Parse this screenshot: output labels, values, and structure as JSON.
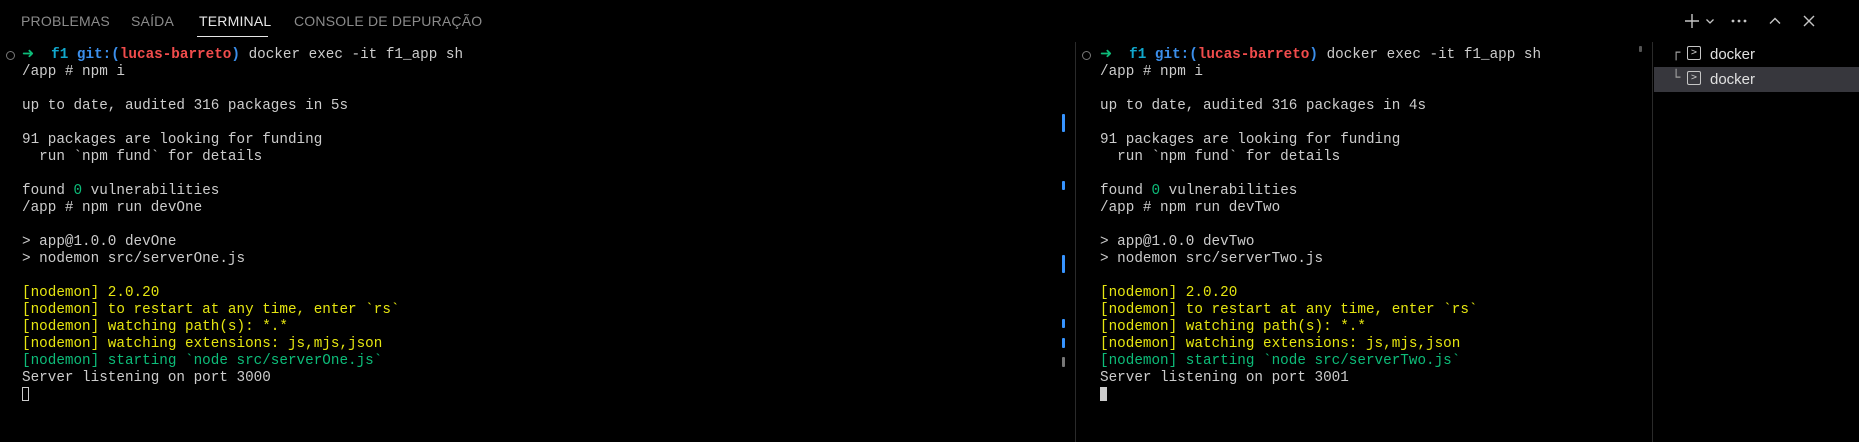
{
  "tabs": [
    {
      "label": "PROBLEMAS",
      "active": false
    },
    {
      "label": "SAÍDA",
      "active": false
    },
    {
      "label": "TERMINAL",
      "active": true
    },
    {
      "label": "CONSOLE DE DEPURAÇÃO",
      "active": false
    }
  ],
  "toolbar": {
    "new_terminal_icon": "plus-icon",
    "dropdown_icon": "chevron-down-icon",
    "more_icon": "ellipsis-icon",
    "maximize_icon": "chevron-up-icon",
    "close_icon": "close-icon"
  },
  "terminals": [
    {
      "prompt_arrow": "➜",
      "folder": "f1",
      "git_prefix": "git:(",
      "branch": "lucas-barreto",
      "git_suffix": ")",
      "command": "docker exec -it f1_app sh",
      "npm_i": "/app # npm i",
      "audited": "up to date, audited 316 packages in 5s",
      "funding1": "91 packages are looking for funding",
      "funding2": "  run `npm fund` for details",
      "found_pre": "found ",
      "vuln_count": "0",
      "found_post": " vulnerabilities",
      "run_cmd": "/app # npm run devOne",
      "app_line": "> app@1.0.0 devOne",
      "nodemon_line": "> nodemon src/serverOne.js",
      "nm1": "[nodemon] 2.0.20",
      "nm2": "[nodemon] to restart at any time, enter `rs`",
      "nm3": "[nodemon] watching path(s): *.*",
      "nm4": "[nodemon] watching extensions: js,mjs,json",
      "nm5": "[nodemon] starting `node src/serverOne.js`",
      "server": "Server listening on port 3000"
    },
    {
      "prompt_arrow": "➜",
      "folder": "f1",
      "git_prefix": "git:(",
      "branch": "lucas-barreto",
      "git_suffix": ")",
      "command": "docker exec -it f1_app sh",
      "npm_i": "/app # npm i",
      "audited": "up to date, audited 316 packages in 4s",
      "funding1": "91 packages are looking for funding",
      "funding2": "  run `npm fund` for details",
      "found_pre": "found ",
      "vuln_count": "0",
      "found_post": " vulnerabilities",
      "run_cmd": "/app # npm run devTwo",
      "app_line": "> app@1.0.0 devTwo",
      "nodemon_line": "> nodemon src/serverTwo.js",
      "nm1": "[nodemon] 2.0.20",
      "nm2": "[nodemon] to restart at any time, enter `rs`",
      "nm3": "[nodemon] watching path(s): *.*",
      "nm4": "[nodemon] watching extensions: js,mjs,json",
      "nm5": "[nodemon] starting `node src/serverTwo.js`",
      "server": "Server listening on port 3001"
    }
  ],
  "terminal_list": [
    {
      "label": "docker",
      "branch_glyph": "┌",
      "selected": false
    },
    {
      "label": "docker",
      "branch_glyph": "└",
      "selected": true
    }
  ],
  "colors": {
    "background": "#000000",
    "prompt_green": "#0dbc79",
    "folder_cyan": "#11a8cd",
    "git_blue": "#3b8eea",
    "branch_red": "#f14c4c",
    "nodemon_yellow": "#e5e510",
    "scroll_marker": "#3794ff"
  }
}
